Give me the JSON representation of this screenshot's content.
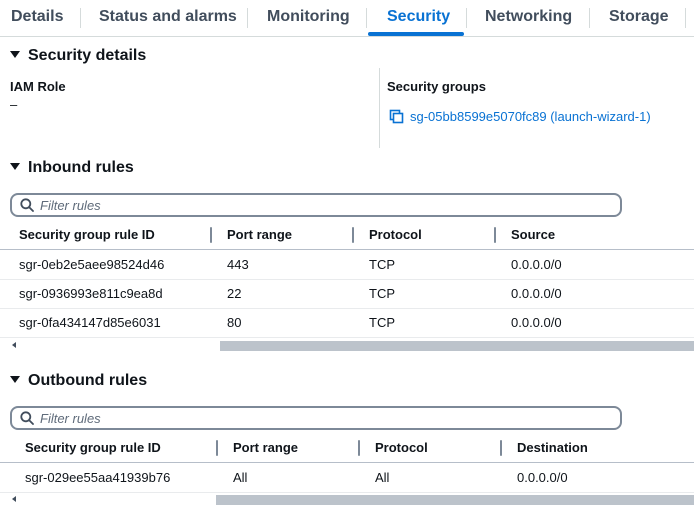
{
  "tabs": [
    {
      "label": "Details"
    },
    {
      "label": "Status and alarms"
    },
    {
      "label": "Monitoring"
    },
    {
      "label": "Security"
    },
    {
      "label": "Networking"
    },
    {
      "label": "Storage"
    }
  ],
  "active_tab": "Security",
  "security_details": {
    "title": "Security details",
    "iam_role_label": "IAM Role",
    "iam_role_value": "–",
    "security_groups_label": "Security groups",
    "security_group_link": "sg-05bb8599e5070fc89 (launch-wizard-1)"
  },
  "inbound": {
    "title": "Inbound rules",
    "filter_placeholder": "Filter rules",
    "columns": [
      "Security group rule ID",
      "Port range",
      "Protocol",
      "Source"
    ],
    "rows": [
      [
        "sgr-0eb2e5aee98524d46",
        "443",
        "TCP",
        "0.0.0.0/0"
      ],
      [
        "sgr-0936993e811c9ea8d",
        "22",
        "TCP",
        "0.0.0.0/0"
      ],
      [
        "sgr-0fa434147d85e6031",
        "80",
        "TCP",
        "0.0.0.0/0"
      ]
    ]
  },
  "outbound": {
    "title": "Outbound rules",
    "filter_placeholder": "Filter rules",
    "columns": [
      "Security group rule ID",
      "Port range",
      "Protocol",
      "Destination"
    ],
    "rows": [
      [
        "sgr-029ee55aa41939b76",
        "All",
        "All",
        "0.0.0.0/0"
      ]
    ]
  },
  "colors": {
    "accent": "#0972d3",
    "text": "#0f141a",
    "border": "#7d8998"
  },
  "icons": {
    "section_toggle": "caret-down-icon",
    "search": "search-icon",
    "link": "copy-icon"
  }
}
